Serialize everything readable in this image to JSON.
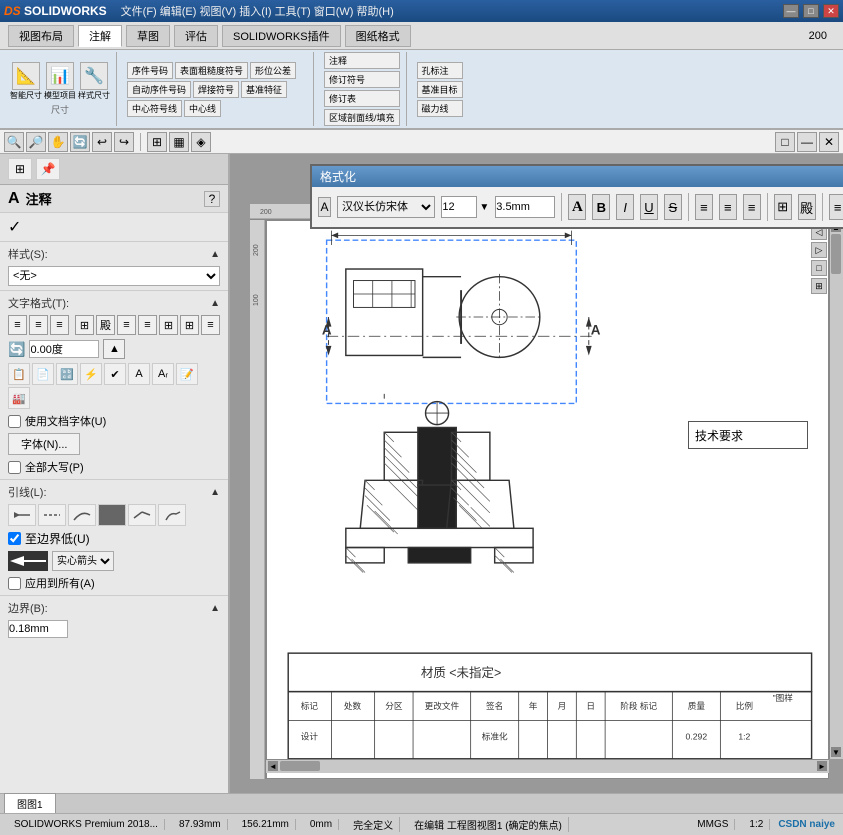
{
  "titlebar": {
    "logo": "DS SOLIDWORKS",
    "title": "文件(F)  编辑(E)  视图(V)  插入(I)  工具(T)  窗口(W)  帮助(H)",
    "min_btn": "—",
    "max_btn": "□",
    "close_btn": "✕"
  },
  "ribbon": {
    "tabs": [
      "视图布局",
      "注解",
      "草图",
      "评估",
      "SOLIDWORKS插件",
      "图纸格式"
    ],
    "active_tab": "注解"
  },
  "toolbar2": {
    "buttons": [
      "视图布局",
      "注解",
      "草图",
      "评估",
      "SOLIDWORKS插件",
      "图纸格式"
    ]
  },
  "format_dialog": {
    "title": "格式化",
    "close": "✕",
    "font": "汉仪长仿宋体",
    "size": "12",
    "height": "3.5mm",
    "format_buttons": [
      "A",
      "B",
      "I",
      "U",
      "S"
    ],
    "align_buttons": [
      "≡",
      "≡",
      "≡",
      "⊞",
      "殿",
      "≡",
      "≡",
      "⊞",
      "⊞",
      "≡"
    ]
  },
  "left_panel": {
    "title": "注释",
    "help_icon": "?",
    "checkmark": "✓",
    "style_label": "样式(S):",
    "style_value": "<无>",
    "text_style_label": "文字格式(T):",
    "angle_label": "0.00度",
    "use_font_checkbox": "使用文档字体(U)",
    "font_btn": "字体(N)...",
    "uppercase_checkbox": "全部大写(P)",
    "leaders_label": "引线(L):",
    "boundary_label": "至边界低(U)",
    "apply_all_checkbox": "应用到所有(A)",
    "border_label": "边界(B):",
    "border_size": "0.18mm"
  },
  "drawing": {
    "tech_req": "技术要求",
    "title_block_row1": [
      "标记",
      "处数",
      "分区",
      "更改文件",
      "签名",
      "年",
      "月",
      "日",
      "阶段 标记",
      "质量",
      "比例"
    ],
    "title_block_row2": [
      "设计",
      "",
      "",
      "标准化",
      "",
      "",
      "",
      "",
      "",
      "0.292",
      "1:2"
    ],
    "material": "材质 <未指定>",
    "drawing_label": "图样"
  },
  "status_bar": {
    "app": "SOLIDWORKS Premium 2018...",
    "measurement1": "87.93mm",
    "measurement2": "156.21mm",
    "status1": "0mm",
    "status2": "完全定义",
    "status3": "在编辑 工程图视图1 (确定的焦点)",
    "scale": "MMGS",
    "ratio": "1:2",
    "watermark": "CSDN  naiye"
  },
  "tabs": {
    "drawing_tab": "图图1"
  }
}
